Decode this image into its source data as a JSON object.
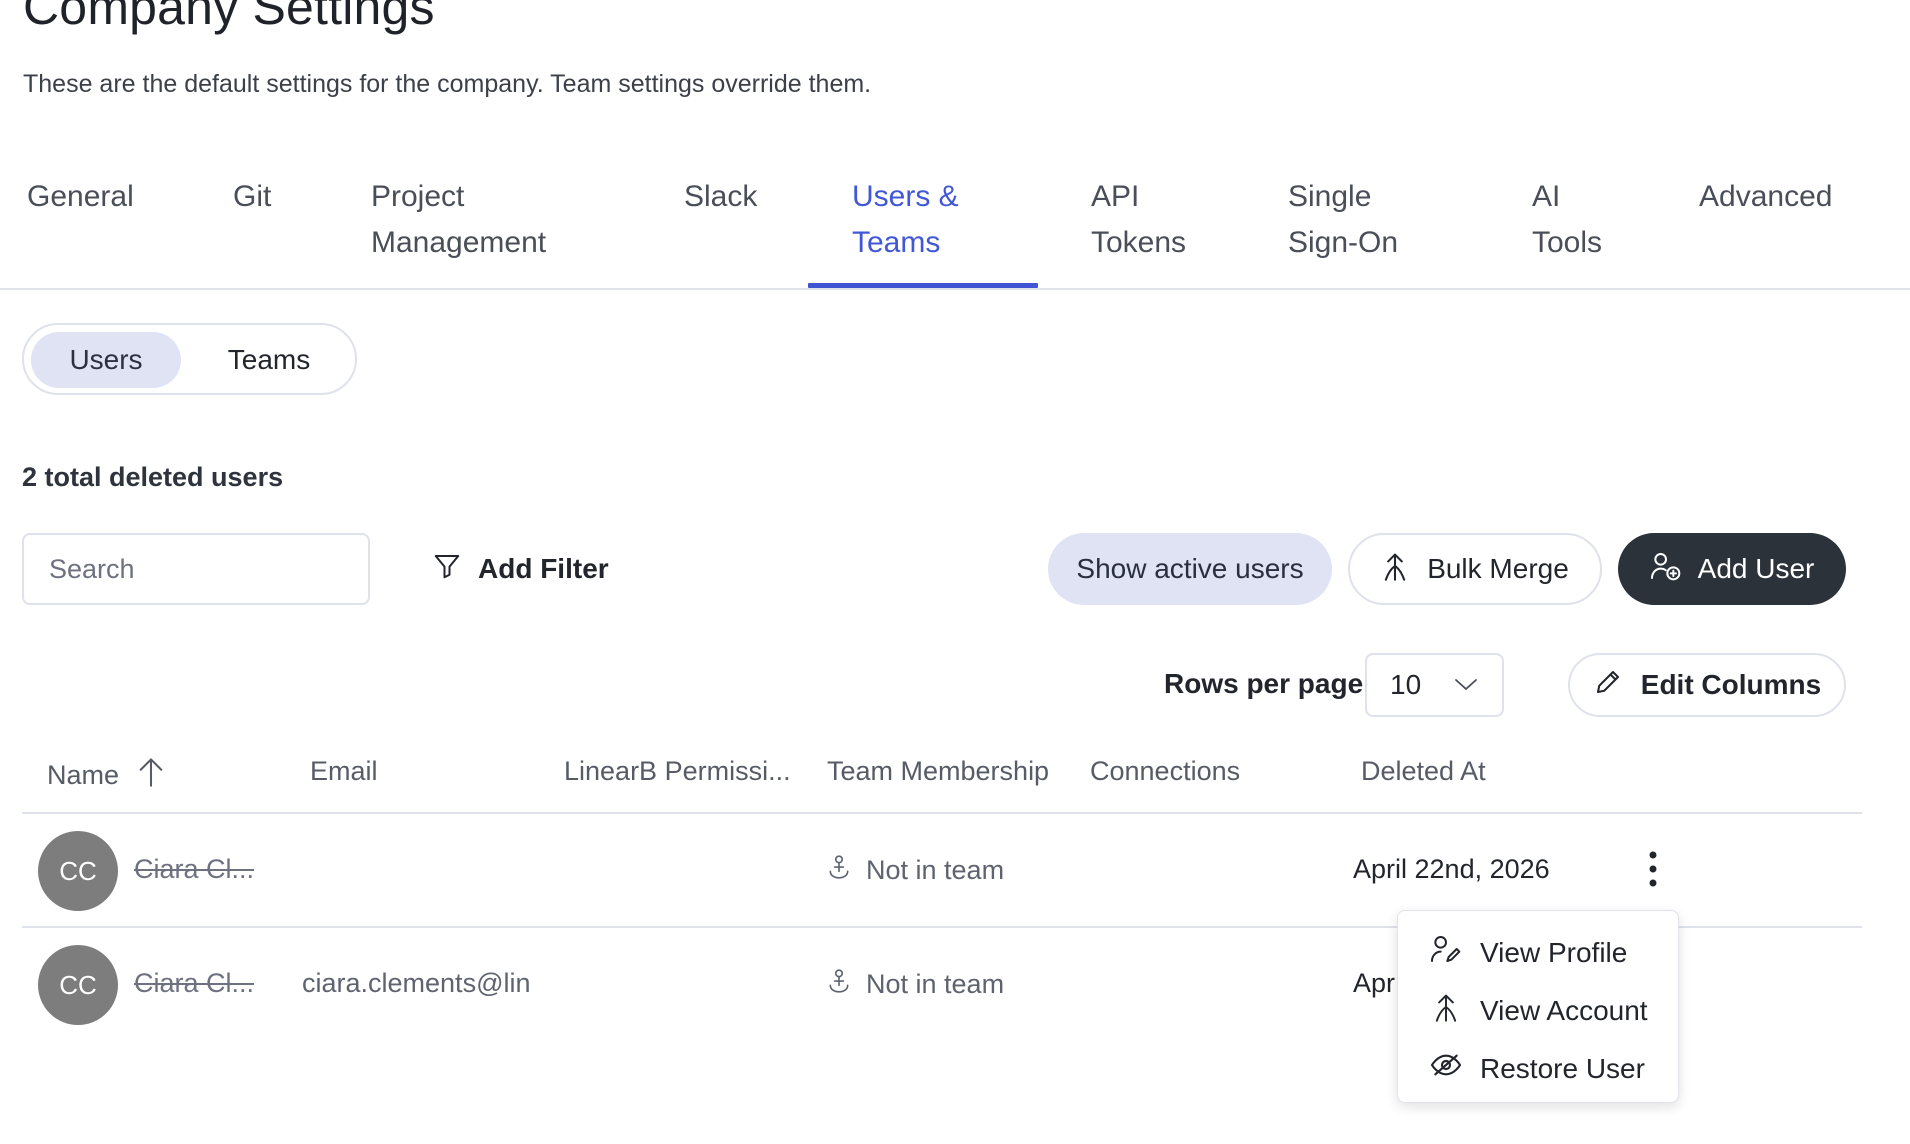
{
  "page": {
    "title": "Company Settings",
    "subtitle": "These are the default settings for the company. Team settings override them."
  },
  "tabs": [
    {
      "line1": "General",
      "line2": ""
    },
    {
      "line1": "Git",
      "line2": ""
    },
    {
      "line1": "Project",
      "line2": "Management"
    },
    {
      "line1": "Slack",
      "line2": ""
    },
    {
      "line1": "Users &",
      "line2": "Teams",
      "active": true
    },
    {
      "line1": "API",
      "line2": "Tokens"
    },
    {
      "line1": "Single",
      "line2": "Sign-On"
    },
    {
      "line1": "AI",
      "line2": "Tools"
    },
    {
      "line1": "Advanced",
      "line2": ""
    }
  ],
  "segment": {
    "users": "Users",
    "teams": "Teams",
    "selected": "Users"
  },
  "summary": {
    "count_text": "2 total deleted users"
  },
  "toolbar": {
    "search_placeholder": "Search",
    "add_filter": "Add Filter",
    "show_active": "Show active users",
    "bulk_merge": "Bulk Merge",
    "add_user": "Add User"
  },
  "pagination": {
    "rows_per_page_label": "Rows per page",
    "rows_per_page_value": "10"
  },
  "edit_columns": "Edit Columns",
  "table": {
    "columns": [
      "Name",
      "Email",
      "LinearB Permissi...",
      "Team Membership",
      "Connections",
      "Deleted At"
    ],
    "rows": [
      {
        "initials": "CC",
        "name": "Ciara Cl...",
        "email": "",
        "team": "Not in team",
        "deleted_at": "April 22nd, 2026"
      },
      {
        "initials": "CC",
        "name": "Ciara Cl...",
        "email": "ciara.clements@lin",
        "team": "Not in team",
        "deleted_at": "Apr"
      }
    ]
  },
  "row_menu": {
    "view_profile": "View Profile",
    "view_account": "View Account",
    "restore_user": "Restore User"
  },
  "colors": {
    "accent": "#3f55d4",
    "dark_button": "#2c323a",
    "soft_button": "#dfe3f3",
    "avatar": "#7d7d7d"
  }
}
